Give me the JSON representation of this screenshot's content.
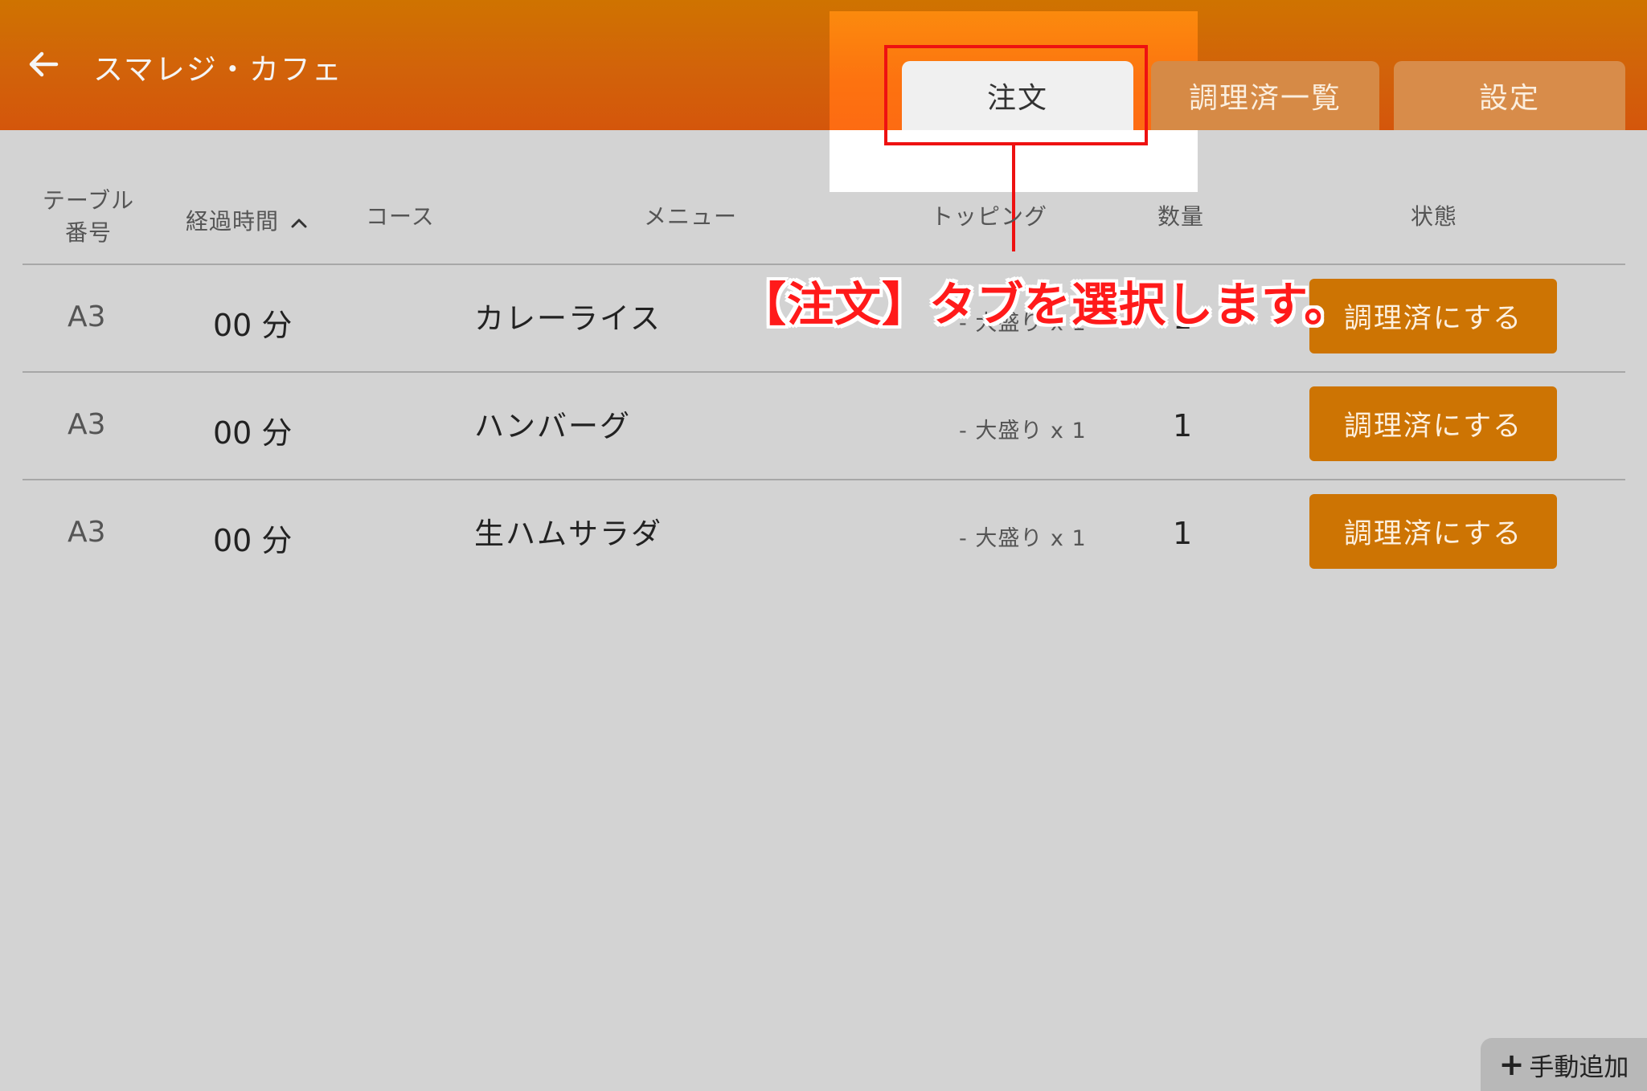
{
  "header": {
    "title": "スマレジ・カフェ",
    "tabs": [
      {
        "label": "注文"
      },
      {
        "label": "調理済一覧"
      },
      {
        "label": "設定"
      }
    ],
    "accent_color": "#d2620a"
  },
  "columns": {
    "table_line1": "テーブル",
    "table_line2": "番号",
    "elapsed": "経過時間",
    "course": "コース",
    "menu": "メニュー",
    "topping": "トッピング",
    "quantity": "数量",
    "status": "状態"
  },
  "orders": [
    {
      "table": "A3",
      "elapsed": "00 分",
      "course": "",
      "menu": "カレーライス",
      "topping": "- 大盛り x 1",
      "quantity": "1",
      "action": "調理済にする"
    },
    {
      "table": "A3",
      "elapsed": "00 分",
      "course": "",
      "menu": "ハンバーグ",
      "topping": "- 大盛り x 1",
      "quantity": "1",
      "action": "調理済にする"
    },
    {
      "table": "A3",
      "elapsed": "00 分",
      "course": "",
      "menu": "生ハムサラダ",
      "topping": "- 大盛り x 1",
      "quantity": "1",
      "action": "調理済にする"
    }
  ],
  "annotation": "【注文】タブを選択します。",
  "footer": {
    "manual_add_icon": "+",
    "manual_add_label": "手動追加"
  },
  "colors": {
    "button": "#cd7403",
    "highlight": "#ee1111",
    "background": "#d3d3d3"
  }
}
